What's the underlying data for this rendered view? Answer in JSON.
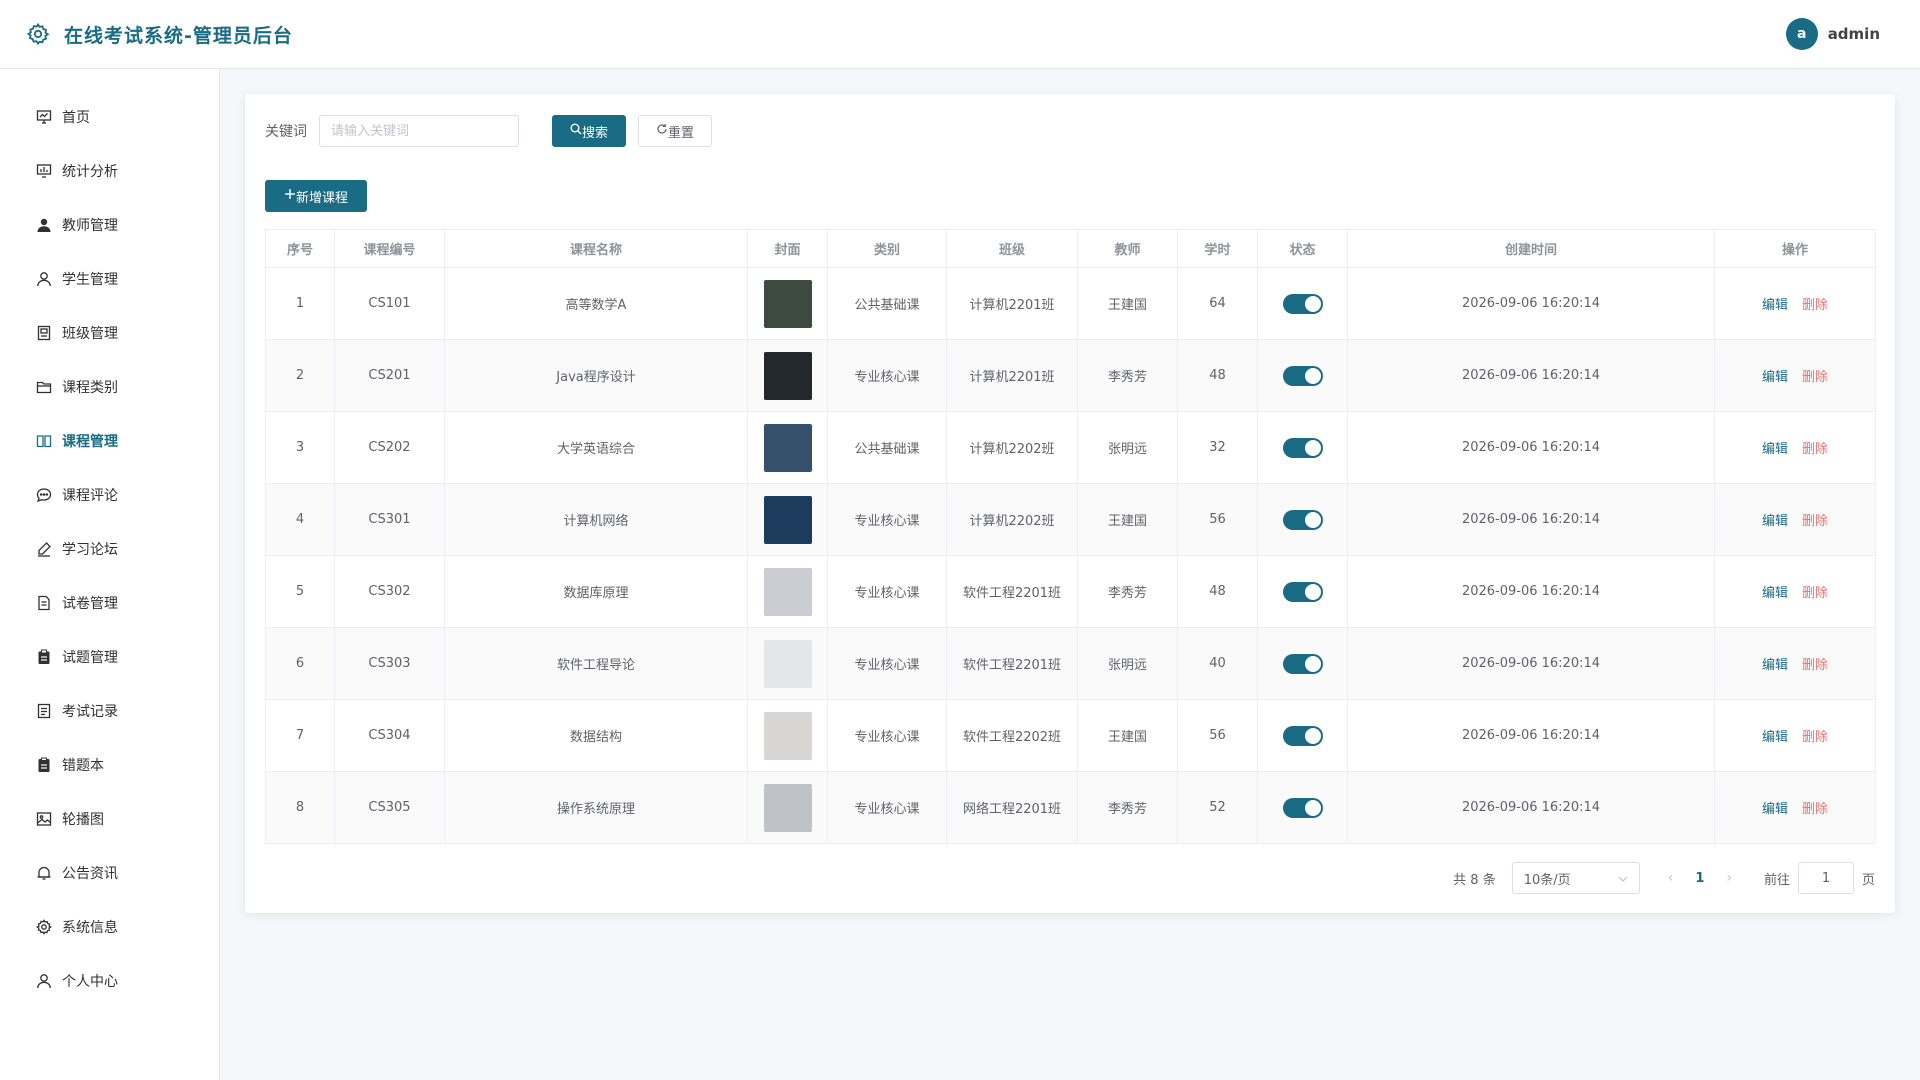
{
  "header": {
    "app_title": "在线考试系统-管理员后台",
    "user_avatar_letter": "a",
    "username": "admin"
  },
  "sidebar": {
    "items": [
      {
        "label": "首页",
        "icon": "dashboard-icon"
      },
      {
        "label": "统计分析",
        "icon": "chart-icon"
      },
      {
        "label": "教师管理",
        "icon": "user-filled-icon"
      },
      {
        "label": "学生管理",
        "icon": "user-icon"
      },
      {
        "label": "班级管理",
        "icon": "class-icon"
      },
      {
        "label": "课程类别",
        "icon": "folder-icon"
      },
      {
        "label": "课程管理",
        "icon": "book-icon",
        "active": true
      },
      {
        "label": "课程评论",
        "icon": "comment-icon"
      },
      {
        "label": "学习论坛",
        "icon": "edit-pen-icon"
      },
      {
        "label": "试卷管理",
        "icon": "document-icon"
      },
      {
        "label": "试题管理",
        "icon": "clipboard-icon"
      },
      {
        "label": "考试记录",
        "icon": "record-icon"
      },
      {
        "label": "错题本",
        "icon": "notebook-icon"
      },
      {
        "label": "轮播图",
        "icon": "picture-icon"
      },
      {
        "label": "公告资讯",
        "icon": "bell-icon"
      },
      {
        "label": "系统信息",
        "icon": "gear-icon"
      },
      {
        "label": "个人中心",
        "icon": "user-icon"
      }
    ]
  },
  "search": {
    "label": "关键词",
    "placeholder": "请输入关键词",
    "value": "",
    "search_btn": "搜索",
    "reset_btn": "重置"
  },
  "add_btn": "新增课程",
  "table": {
    "columns": [
      "序号",
      "课程编号",
      "课程名称",
      "封面",
      "类别",
      "班级",
      "教师",
      "学时",
      "状态",
      "创建时间",
      "操作"
    ],
    "edit_label": "编辑",
    "delete_label": "删除",
    "rows": [
      {
        "no": "1",
        "code": "CS101",
        "name": "高等数学A",
        "category": "公共基础课",
        "class": "计算机2201班",
        "teacher": "王建国",
        "hours": "64",
        "status": true,
        "created": "2026-09-06 16:20:14",
        "cover_color": "#3d4a3f"
      },
      {
        "no": "2",
        "code": "CS201",
        "name": "Java程序设计",
        "category": "专业核心课",
        "class": "计算机2201班",
        "teacher": "李秀芳",
        "hours": "48",
        "status": true,
        "created": "2026-09-06 16:20:14",
        "cover_color": "#23282d"
      },
      {
        "no": "3",
        "code": "CS202",
        "name": "大学英语综合",
        "category": "公共基础课",
        "class": "计算机2202班",
        "teacher": "张明远",
        "hours": "32",
        "status": true,
        "created": "2026-09-06 16:20:14",
        "cover_color": "#35506b"
      },
      {
        "no": "4",
        "code": "CS301",
        "name": "计算机网络",
        "category": "专业核心课",
        "class": "计算机2202班",
        "teacher": "王建国",
        "hours": "56",
        "status": true,
        "created": "2026-09-06 16:20:14",
        "cover_color": "#1d3b5c"
      },
      {
        "no": "5",
        "code": "CS302",
        "name": "数据库原理",
        "category": "专业核心课",
        "class": "软件工程2201班",
        "teacher": "李秀芳",
        "hours": "48",
        "status": true,
        "created": "2026-09-06 16:20:14",
        "cover_color": "#c9ccd0"
      },
      {
        "no": "6",
        "code": "CS303",
        "name": "软件工程导论",
        "category": "专业核心课",
        "class": "软件工程2201班",
        "teacher": "张明远",
        "hours": "40",
        "status": true,
        "created": "2026-09-06 16:20:14",
        "cover_color": "#e4e6e8"
      },
      {
        "no": "7",
        "code": "CS304",
        "name": "数据结构",
        "category": "专业核心课",
        "class": "软件工程2202班",
        "teacher": "王建国",
        "hours": "56",
        "status": true,
        "created": "2026-09-06 16:20:14",
        "cover_color": "#d8d6d2"
      },
      {
        "no": "8",
        "code": "CS305",
        "name": "操作系统原理",
        "category": "专业核心课",
        "class": "网络工程2201班",
        "teacher": "李秀芳",
        "hours": "52",
        "status": true,
        "created": "2026-09-06 16:20:14",
        "cover_color": "#bfc3c7"
      }
    ]
  },
  "pagination": {
    "total_text": "共 8 条",
    "page_size": "10条/页",
    "current_page": "1",
    "goto_label": "前往",
    "goto_value": "1",
    "page_suffix": "页"
  },
  "colors": {
    "primary": "#1a6b84",
    "danger": "#f56c6c"
  }
}
